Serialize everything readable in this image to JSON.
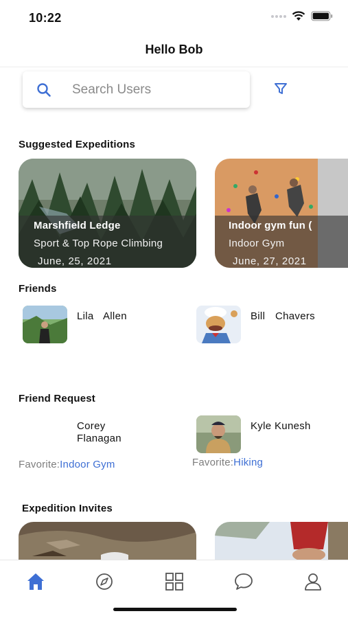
{
  "status_bar": {
    "time": "10:22"
  },
  "header": {
    "title": "Hello Bob"
  },
  "search": {
    "placeholder": "Search Users"
  },
  "sections": {
    "suggested": "Suggested Expeditions",
    "friends": "Friends",
    "requests": "Friend Request",
    "invites": "Expedition Invites"
  },
  "suggested_expeditions": [
    {
      "name": "Marshfield Ledge",
      "type": "Sport & Top Rope Climbing",
      "date": "June, 25, 2021"
    },
    {
      "name": "Indoor gym fun (",
      "type": "Indoor Gym",
      "date": "June, 27, 2021"
    }
  ],
  "friends": [
    {
      "first": "Lila",
      "last": "Allen"
    },
    {
      "first": "Bill",
      "last": "Chavers"
    }
  ],
  "friend_requests": [
    {
      "first": "Corey",
      "last": "Flanagan",
      "favorite_label": "Favorite:",
      "favorite": "Indoor Gym"
    },
    {
      "first": "Kyle",
      "last": "Kunesh",
      "favorite_label": "Favorite:",
      "favorite": "Hiking"
    }
  ],
  "tabs": [
    "home-icon",
    "compass-icon",
    "grid-icon",
    "chat-icon",
    "profile-icon"
  ],
  "colors": {
    "accent": "#3e6fd4",
    "text": "#111111",
    "muted": "#7d7d7d"
  }
}
